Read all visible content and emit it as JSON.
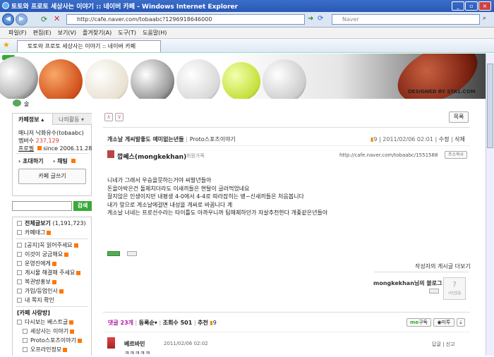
{
  "window": {
    "title": "토토와 프로토 세상사는 이야기 :: 네이버 카페 - Windows Internet Explorer"
  },
  "address": {
    "url": "http://cafe.naver.com/tobaabc?1296918646000",
    "search_placeholder": "Naver"
  },
  "menu": [
    "파일(F)",
    "편집(E)",
    "보기(V)",
    "즐겨찾기(A)",
    "도구(T)",
    "도움말(H)"
  ],
  "tab": {
    "label": "토토와 프로토 세상사는 이야기 :: 네이버 카페"
  },
  "banner": {
    "credit": "DESIGNED BY STA1.COM"
  },
  "breadcrumb": "술",
  "sidebar": {
    "tab_info": "카페정보",
    "tab_activity": "나의활동",
    "manager_label": "매니저",
    "manager_name": "낙화유수(tobaabc)",
    "members_label": "멤버수",
    "members_count": "237,129",
    "profile_label": "프로필",
    "since": "since 2006.11.28",
    "invite": "초대하기",
    "chat": "채팅",
    "write_button": "카페 글쓰기",
    "search_button": "검색",
    "all_posts": "전체글보기",
    "all_posts_count": "(1,191,723)",
    "cafe_tag": "카페태그",
    "menu1": [
      "[공지]꼭 읽어주세요",
      "이것이 궁금해요",
      "운영진에게",
      "게시물 해결해 주세요",
      "복권방홍보",
      "가입/등업인사",
      "내 쪽지 확인"
    ],
    "section_label": "[카페 사랑방]",
    "menu2": [
      "다시보는 베스트글",
      "세상사는 이야기",
      "Proto스포츠이야기",
      "오프라인정모"
    ]
  },
  "list_button": "목록",
  "post": {
    "title": "개소날 게씨발좋도 예미없는년들",
    "category": "Proto스포츠이야기",
    "views": "9",
    "date": "2011/02/06 02:01",
    "edit": "수정",
    "delete": "삭제",
    "author": "깝쎄스(mongkekhan)",
    "author_tag": "회원가족",
    "permalink": "http://cafe.naver.com/tobaabc/1551588",
    "copy_btn": "주소복사",
    "body": [
      "니네가 그래서 우승을뭇하는거야 씨발년들아",
      "돈을아박은건 돌체치더라도 이새끼들은 현탈이 글러먹었네요",
      "잘지않은 인생이지만 내평생 4-0에서 4-4로 따라잡히는 병~신새끼들은 처음봅니다",
      "내가 앞으로 게소날에걸면 내성을 개씨로 바꿉니다 계",
      "게소날 너네는 프로선수라는 타이틀도 아까우니까 팀해체하던가 자살추천한다 개좆같은년들아"
    ],
    "more_link": "작성자의 게시글 더보기",
    "blog_link": "mongkekhan님의 블로그",
    "photo_label": "사진없음"
  },
  "comments": {
    "count_label": "댓글 23개",
    "order_label": "등록순",
    "views_label": "조회수 501",
    "recommend_label": "추천",
    "recommend_count": "9",
    "subscribe": "구독",
    "print": "미투",
    "commenter": "베르바민",
    "comment_date": "2011/02/06 02:02",
    "comment_text": "ㅋㅋㅋㅋㅋ",
    "reply": "답글",
    "report": "신고"
  }
}
